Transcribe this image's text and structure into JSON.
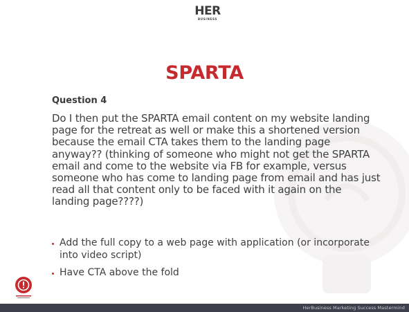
{
  "logo": {
    "main": "HER",
    "sub": "BUSINESS"
  },
  "slide": {
    "title": "SPARTA",
    "subtitle": "Question 4",
    "body": "Do I then put the SPARTA email content on my website landing page for the retreat as well or make this a shortened version because the email CTA takes them to the landing page anyway?? (thinking of someone who might not get the SPARTA email and come to the website via FB for example, versus someone who has come to landing page from email and has just read all that content only to be faced with it again on the landing page????)",
    "bullets": [
      "Add the full copy to a web page with application (or incorporate into video script)",
      "Have CTA above the fold"
    ]
  },
  "badge": {
    "icon": "alert-bulb-icon"
  },
  "footer": {
    "text": "HerBusiness Marketing Success Mastermind"
  },
  "colors": {
    "accent": "#c42a2e",
    "footer_bg": "#3d3f4b",
    "text": "#3f3f3f"
  }
}
